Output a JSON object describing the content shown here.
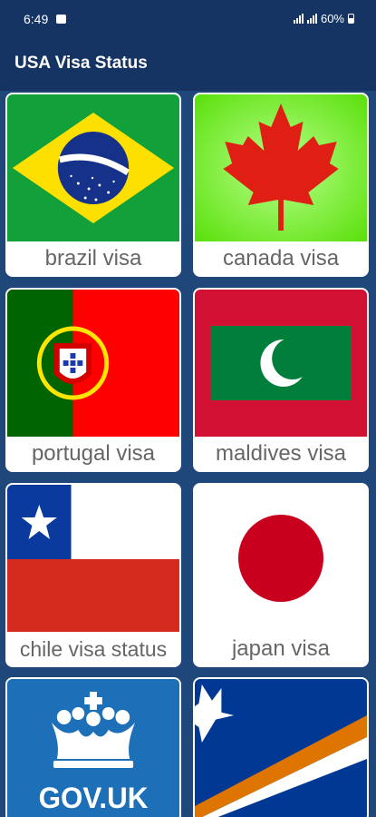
{
  "status_bar": {
    "time": "6:49",
    "battery": "60%"
  },
  "app_bar": {
    "title": "USA Visa Status"
  },
  "cards": [
    {
      "label": "brazil visa",
      "flag": "brazil-flag"
    },
    {
      "label": "canada visa",
      "flag": "canada-flag"
    },
    {
      "label": "portugal visa",
      "flag": "portugal-flag"
    },
    {
      "label": "maldives visa",
      "flag": "maldives-flag"
    },
    {
      "label": "chile visa status",
      "flag": "chile-flag"
    },
    {
      "label": "japan visa",
      "flag": "japan-flag"
    },
    {
      "label": "",
      "flag": "gov-uk-logo",
      "logo_text": "GOV.UK"
    },
    {
      "label": "",
      "flag": "marshall-islands-flag"
    }
  ],
  "colors": {
    "background": "#1f4779",
    "app_bar": "#153463",
    "label_text": "#666666"
  }
}
